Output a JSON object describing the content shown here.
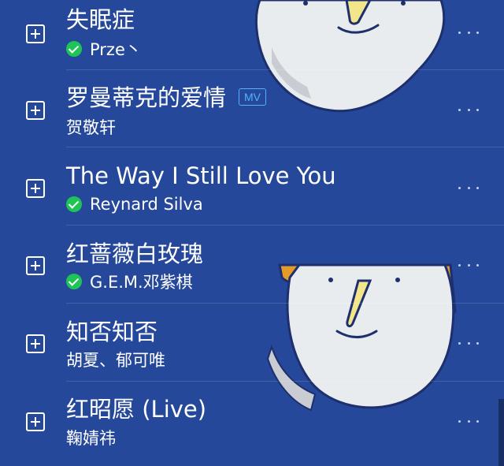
{
  "colors": {
    "background": "#26489a",
    "text": "#ffffff",
    "check_badge": "#1fc456",
    "mv_badge": "#4fb3ff"
  },
  "songs": [
    {
      "title": "失眠症",
      "artist": "Prze丶",
      "verified": true,
      "mv": null
    },
    {
      "title": "罗曼蒂克的爱情",
      "artist": "贺敬轩",
      "verified": false,
      "mv": "MV"
    },
    {
      "title": "The Way I Still Love You",
      "artist": "Reynard Silva",
      "verified": true,
      "mv": null
    },
    {
      "title": "红蔷薇白玫瑰",
      "artist": "G.E.M.邓紫棋",
      "verified": true,
      "mv": null
    },
    {
      "title": "知否知否",
      "artist": "胡夏、郁可唯",
      "verified": false,
      "mv": null
    },
    {
      "title": "红昭愿 (Live)",
      "artist": "鞠婧祎",
      "verified": false,
      "mv": null
    }
  ],
  "icons": {
    "add": "add-square-icon",
    "verified": "check-circle-icon",
    "more": "more-dots-icon"
  }
}
